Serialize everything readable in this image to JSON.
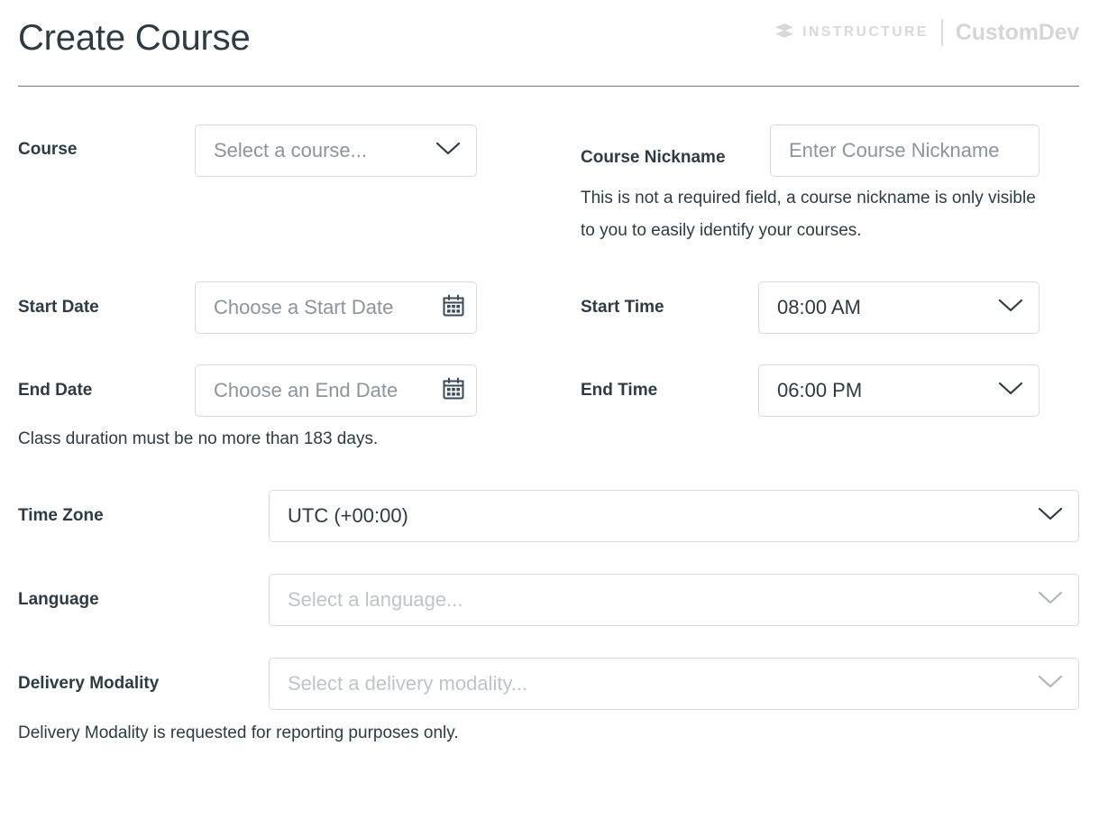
{
  "header": {
    "title": "Create Course",
    "brand": {
      "instructure": "INSTRUCTURE",
      "product": "CustomDev",
      "mark_icon": "instructure-layers-icon"
    }
  },
  "form": {
    "course": {
      "label": "Course",
      "placeholder": "Select a course...",
      "value": "",
      "chevron_icon": "chevron-down-icon"
    },
    "course_nickname": {
      "label": "Course Nickname",
      "placeholder": "Enter Course Nickname",
      "placeholder_visible": "Enter Course Nickna",
      "value": "",
      "help": "This is not a required field, a course nickname is only visible to you to easily identify your courses."
    },
    "start_date": {
      "label": "Start Date",
      "placeholder": "Choose a Start Date",
      "placeholder_visible": "Choose a Start Da",
      "value": "",
      "icon": "calendar-icon"
    },
    "end_date": {
      "label": "End Date",
      "placeholder": "Choose an End Date",
      "placeholder_visible": "Choose an End Da",
      "value": "",
      "icon": "calendar-icon",
      "help": "Class duration must be no more than 183 days."
    },
    "start_time": {
      "label": "Start Time",
      "value": "08:00 AM",
      "chevron_icon": "chevron-down-icon"
    },
    "end_time": {
      "label": "End Time",
      "value": "06:00 PM",
      "chevron_icon": "chevron-down-icon"
    },
    "time_zone": {
      "label": "Time Zone",
      "value": "UTC (+00:00)",
      "chevron_icon": "chevron-down-icon"
    },
    "language": {
      "label": "Language",
      "placeholder": "Select a language...",
      "value": "",
      "chevron_icon": "chevron-down-icon"
    },
    "delivery_modality": {
      "label": "Delivery Modality",
      "placeholder": "Select a delivery modality...",
      "value": "",
      "chevron_icon": "chevron-down-icon",
      "help": "Delivery Modality is requested for reporting purposes only."
    }
  },
  "colors": {
    "text": "#2D3B45",
    "placeholder": "#8B959E",
    "placeholder_light": "#BFC4C9",
    "border": "#D7DADE",
    "rule": "#6B7780",
    "brand_gray": "#D6D6D6"
  }
}
